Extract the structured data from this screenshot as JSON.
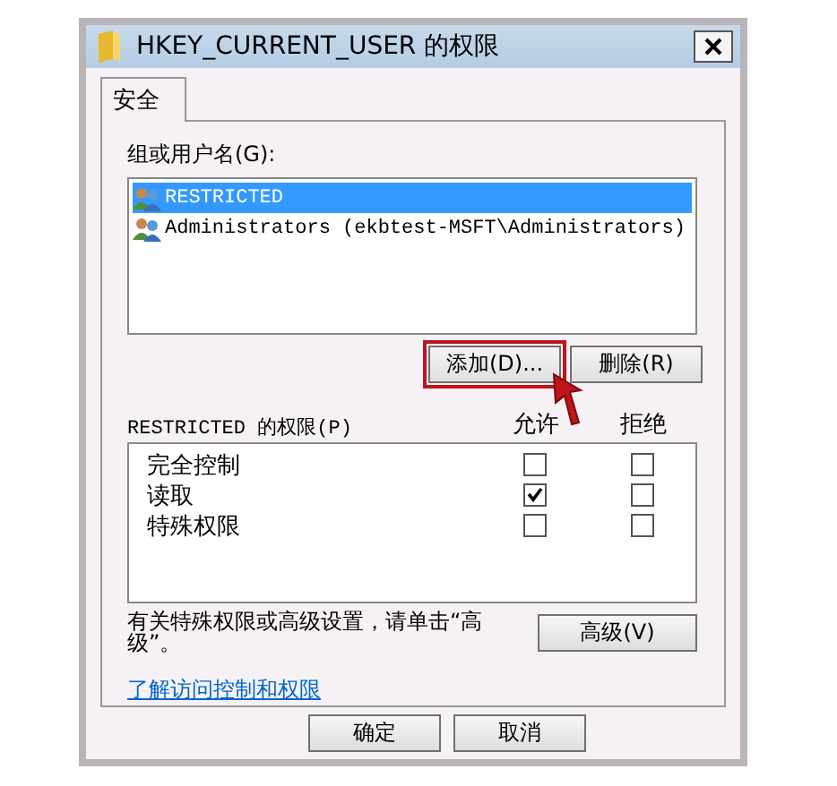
{
  "window": {
    "title": "HKEY_CURRENT_USER 的权限"
  },
  "tabs": [
    {
      "label": "安全",
      "selected": true
    }
  ],
  "groups": {
    "label": "组或用户名(G):",
    "users": [
      {
        "name": "RESTRICTED",
        "selected": true
      },
      {
        "name": "Administrators (ekbtest-MSFT\\Administrators)",
        "selected": false
      }
    ]
  },
  "group_buttons": [
    {
      "label": "添加(D)...",
      "highlighted": true
    },
    {
      "label": "删除(R)",
      "highlighted": false
    }
  ],
  "permissions": {
    "label": "RESTRICTED 的权限(P)",
    "columns": [
      "允许",
      "拒绝"
    ],
    "rows": [
      {
        "name": "完全控制",
        "allow": false,
        "deny": false
      },
      {
        "name": "读取",
        "allow": true,
        "deny": false
      },
      {
        "name": "特殊权限",
        "allow": false,
        "deny": false
      }
    ]
  },
  "advanced": {
    "note": "有关特殊权限或高级设置，请单击“高级”。",
    "button": "高级(V)"
  },
  "link": "了解访问控制和权限",
  "footer_buttons": [
    "确定",
    "取消"
  ]
}
